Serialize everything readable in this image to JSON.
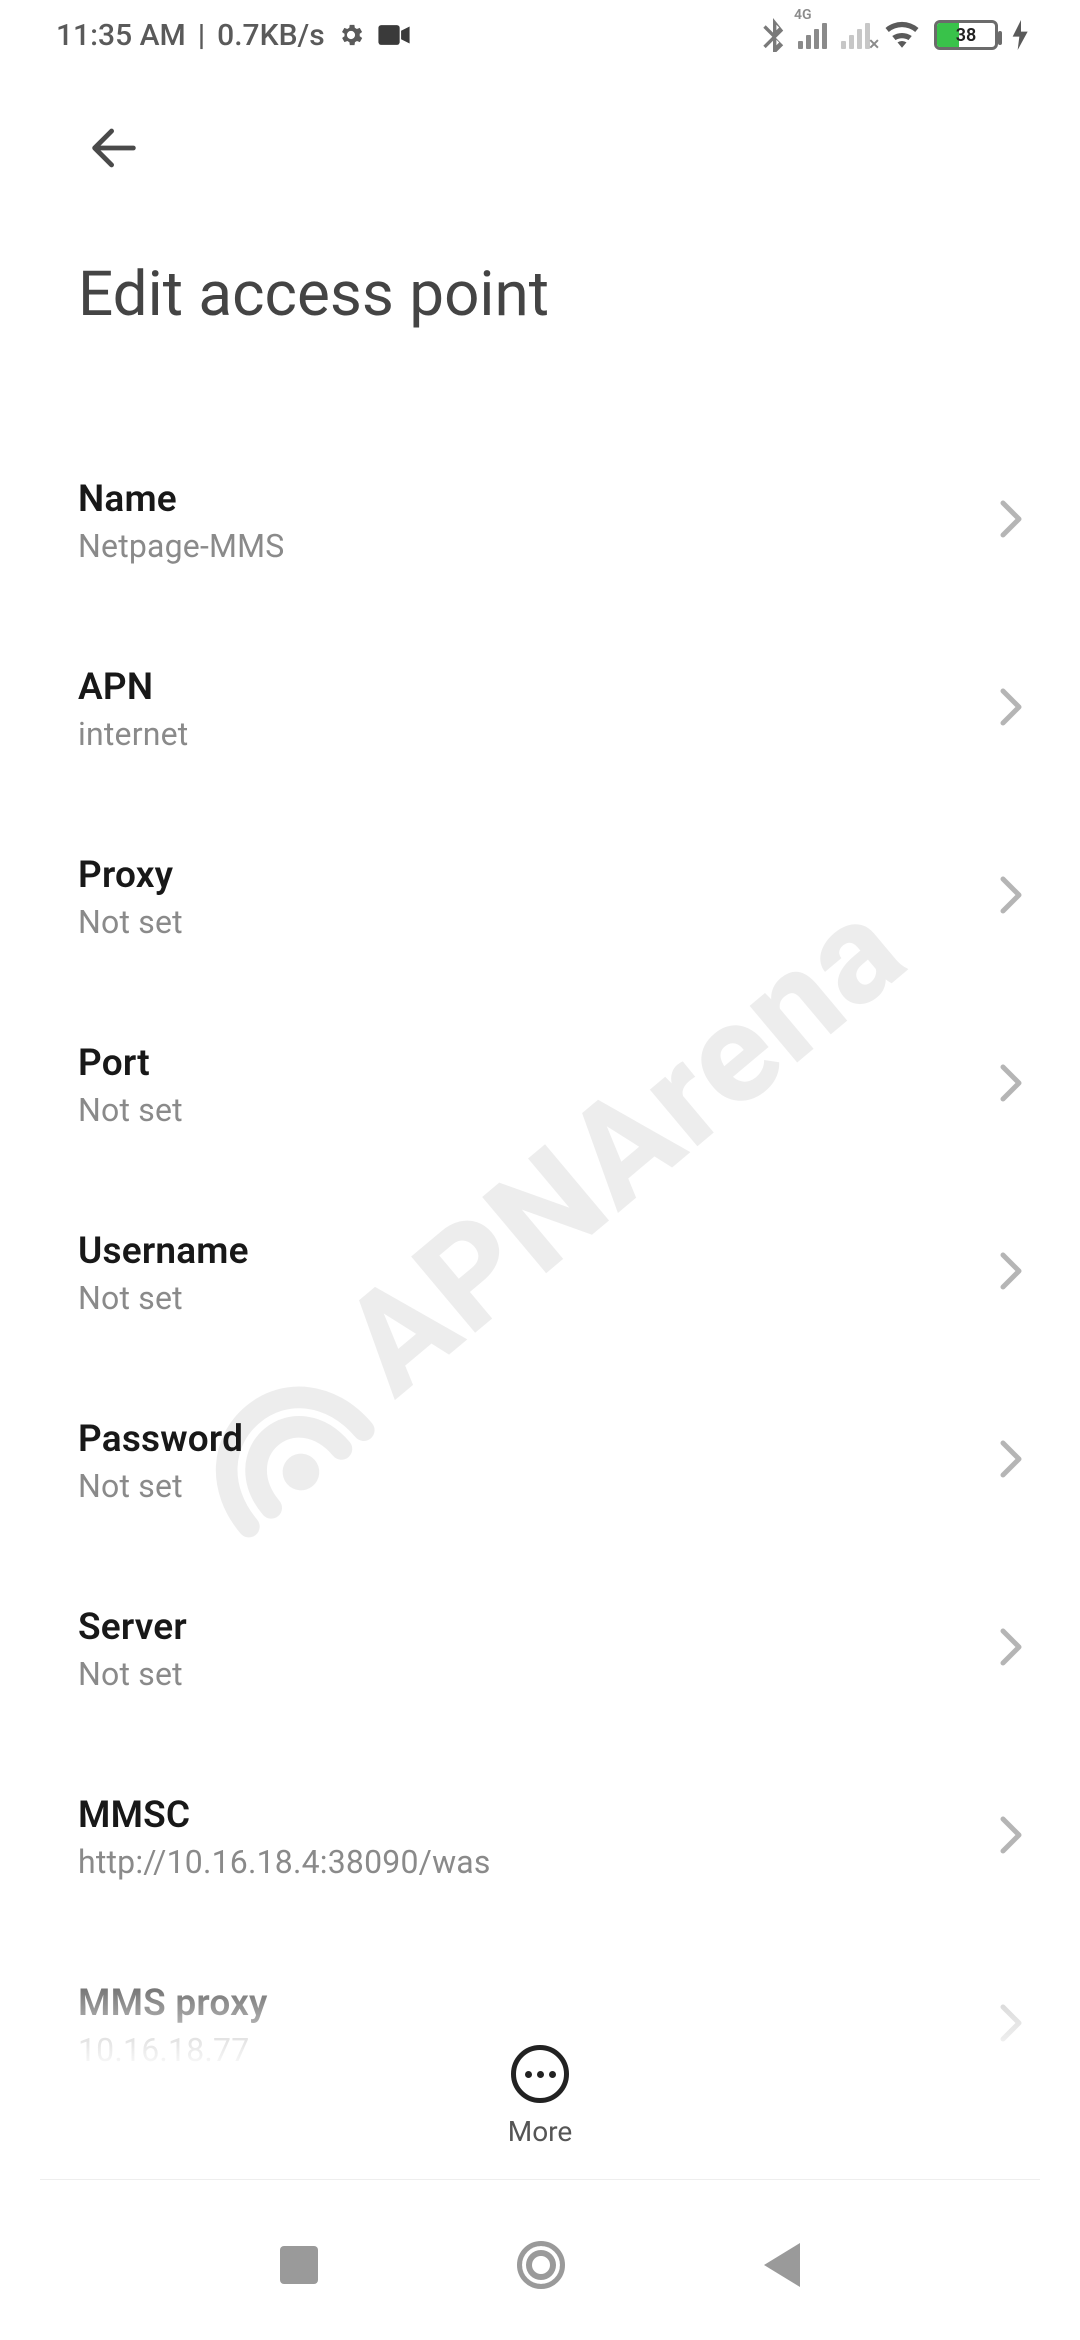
{
  "status": {
    "time": "11:35 AM",
    "speed": "0.7KB/s",
    "battery_pct": "38",
    "signal1_label": "4G"
  },
  "header": {
    "title": "Edit access point"
  },
  "settings": [
    {
      "label": "Name",
      "value": "Netpage-MMS"
    },
    {
      "label": "APN",
      "value": "internet"
    },
    {
      "label": "Proxy",
      "value": "Not set"
    },
    {
      "label": "Port",
      "value": "Not set"
    },
    {
      "label": "Username",
      "value": "Not set"
    },
    {
      "label": "Password",
      "value": "Not set"
    },
    {
      "label": "Server",
      "value": "Not set"
    },
    {
      "label": "MMSC",
      "value": "http://10.16.18.4:38090/was"
    },
    {
      "label": "MMS proxy",
      "value": "10.16.18.77"
    }
  ],
  "more_label": "More",
  "watermark": "APNArena"
}
